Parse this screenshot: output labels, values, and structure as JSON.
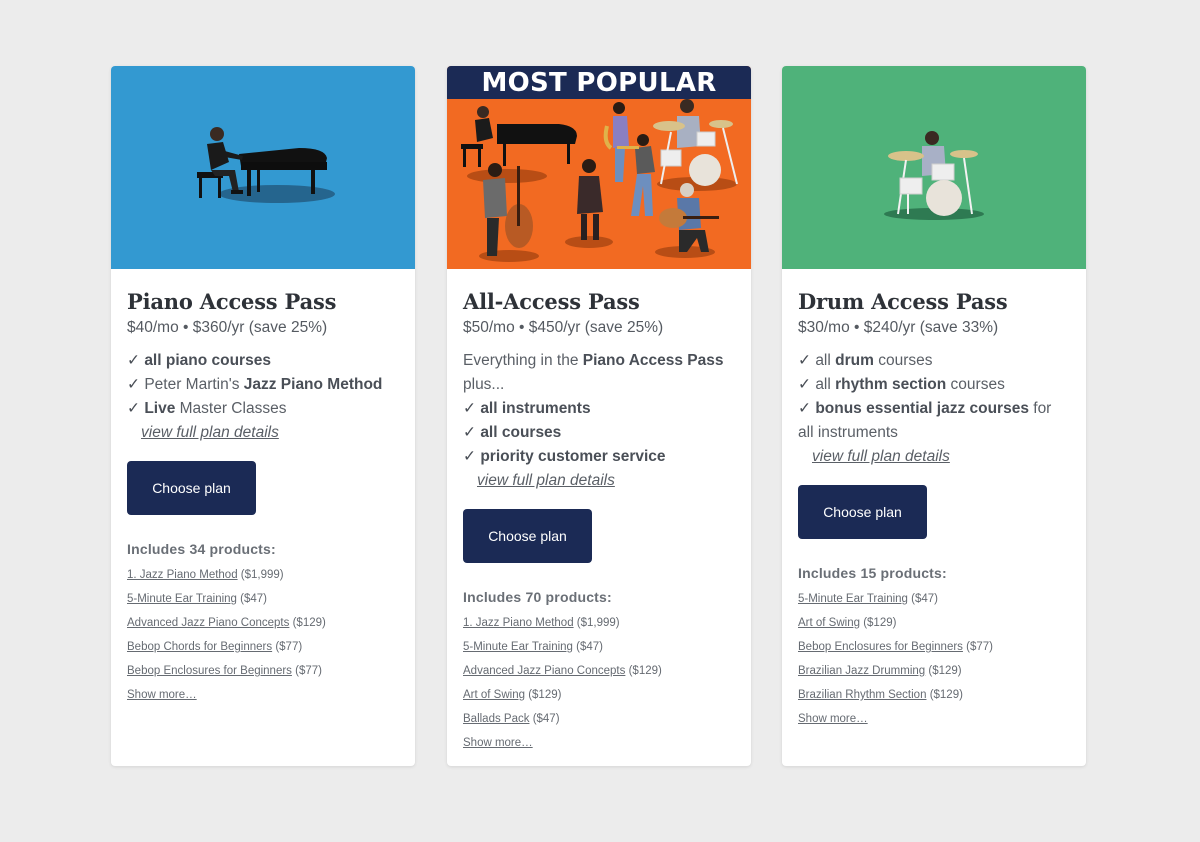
{
  "colors": {
    "page_bg": "#ececec",
    "button_bg": "#1b2a55",
    "piano_hero": "#3399d1",
    "all_hero": "#f26a22",
    "drum_hero": "#4fb27a",
    "banner_bg": "#1b2a55"
  },
  "cards": [
    {
      "id": "piano",
      "hero_image": "piano-player-illustration",
      "title": "Piano Access Pass",
      "price": "$40/mo • $360/yr (save 25%)",
      "features": [
        {
          "check": "✓",
          "pre": "",
          "bold": "all piano courses",
          "post": ""
        },
        {
          "check": "✓",
          "pre": "Peter Martin's ",
          "bold": "Jazz Piano Method",
          "post": ""
        },
        {
          "check": "✓",
          "pre": "",
          "bold": "Live",
          "post": " Master Classes"
        }
      ],
      "details_link": "view full plan details",
      "button": "Choose plan",
      "includes": "Includes 34 products:",
      "products": [
        {
          "name": "1. Jazz Piano Method",
          "price": "($1,999)"
        },
        {
          "name": "5-Minute Ear Training",
          "price": "($47)"
        },
        {
          "name": "Advanced Jazz Piano Concepts",
          "price": "($129)"
        },
        {
          "name": "Bebop Chords for Beginners",
          "price": "($77)"
        },
        {
          "name": "Bebop Enclosures for Beginners",
          "price": "($77)"
        }
      ],
      "show_more": "Show more…"
    },
    {
      "id": "all",
      "banner": "MOST POPULAR",
      "hero_image": "jazz-band-illustration",
      "title": "All-Access Pass",
      "price": "$50/mo • $450/yr (save 25%)",
      "intro_pre": "Everything in the ",
      "intro_bold": "Piano Access Pass",
      "intro_post": " plus...",
      "features": [
        {
          "check": "✓",
          "pre": "",
          "bold": "all instruments",
          "post": ""
        },
        {
          "check": "✓",
          "pre": "",
          "bold": "all courses",
          "post": ""
        },
        {
          "check": "✓",
          "pre": "",
          "bold": "priority customer service",
          "post": ""
        }
      ],
      "details_link": "view full plan details",
      "button": "Choose plan",
      "includes": "Includes 70 products:",
      "products": [
        {
          "name": "1. Jazz Piano Method",
          "price": "($1,999)"
        },
        {
          "name": "5-Minute Ear Training",
          "price": "($47)"
        },
        {
          "name": "Advanced Jazz Piano Concepts",
          "price": "($129)"
        },
        {
          "name": "Art of Swing",
          "price": "($129)"
        },
        {
          "name": "Ballads Pack",
          "price": "($47)"
        }
      ],
      "show_more": "Show more…"
    },
    {
      "id": "drum",
      "hero_image": "drummer-illustration",
      "title": "Drum Access Pass",
      "price": "$30/mo • $240/yr (save 33%)",
      "features": [
        {
          "check": "✓",
          "pre": "all ",
          "bold": "drum",
          "post": " courses"
        },
        {
          "check": "✓",
          "pre": "all ",
          "bold": "rhythm section",
          "post": " courses"
        },
        {
          "check": "✓",
          "pre": "",
          "bold": "bonus essential jazz courses",
          "post": " for all instruments"
        }
      ],
      "details_link": "view full plan details",
      "button": "Choose plan",
      "includes": "Includes 15 products:",
      "products": [
        {
          "name": "5-Minute Ear Training",
          "price": "($47)"
        },
        {
          "name": "Art of Swing",
          "price": "($129)"
        },
        {
          "name": "Bebop Enclosures for Beginners",
          "price": "($77)"
        },
        {
          "name": "Brazilian Jazz Drumming",
          "price": "($129)"
        },
        {
          "name": "Brazilian Rhythm Section",
          "price": "($129)"
        }
      ],
      "show_more": "Show more…"
    }
  ]
}
